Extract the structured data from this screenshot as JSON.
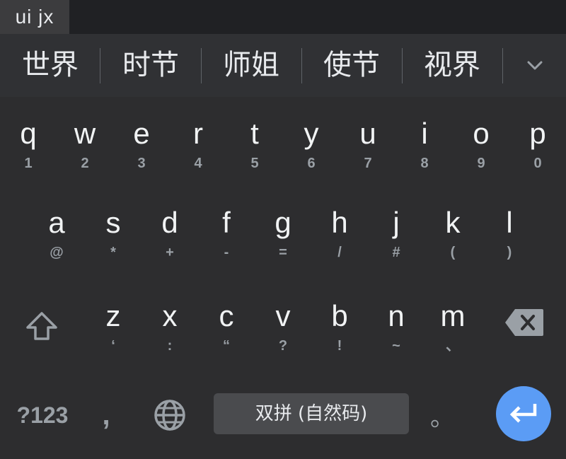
{
  "compose": {
    "text": "ui jx"
  },
  "candidates": {
    "items": [
      "世界",
      "时节",
      "师姐",
      "使节",
      "视界"
    ],
    "expand_icon": "chevron-down-icon"
  },
  "keyboard": {
    "row1": [
      {
        "main": "q",
        "hint": "1"
      },
      {
        "main": "w",
        "hint": "2"
      },
      {
        "main": "e",
        "hint": "3"
      },
      {
        "main": "r",
        "hint": "4"
      },
      {
        "main": "t",
        "hint": "5"
      },
      {
        "main": "y",
        "hint": "6"
      },
      {
        "main": "u",
        "hint": "7"
      },
      {
        "main": "i",
        "hint": "8"
      },
      {
        "main": "o",
        "hint": "9"
      },
      {
        "main": "p",
        "hint": "0"
      }
    ],
    "row2": [
      {
        "main": "a",
        "hint": "@"
      },
      {
        "main": "s",
        "hint": "*"
      },
      {
        "main": "d",
        "hint": "+"
      },
      {
        "main": "f",
        "hint": "-"
      },
      {
        "main": "g",
        "hint": "="
      },
      {
        "main": "h",
        "hint": "/"
      },
      {
        "main": "j",
        "hint": "#"
      },
      {
        "main": "k",
        "hint": "("
      },
      {
        "main": "l",
        "hint": ")"
      }
    ],
    "row3": [
      {
        "main": "z",
        "hint": "‘"
      },
      {
        "main": "x",
        "hint": ":"
      },
      {
        "main": "c",
        "hint": "“"
      },
      {
        "main": "v",
        "hint": "?"
      },
      {
        "main": "b",
        "hint": "!"
      },
      {
        "main": "n",
        "hint": "~"
      },
      {
        "main": "m",
        "hint": "、"
      }
    ],
    "shift_icon": "shift-icon",
    "backspace_icon": "backspace-icon",
    "symbols_label": "?123",
    "comma_label": ",",
    "globe_icon": "globe-icon",
    "space_label": "双拼 (自然码)",
    "period_label": "。",
    "enter_icon": "enter-icon"
  },
  "colors": {
    "background": "#2d2d2f",
    "candidate_bar": "#303134",
    "key_text": "#f1f3f4",
    "hint_text": "#9aa0a6",
    "space_key": "#4a4b4e",
    "enter_accent": "#5b9cf5"
  }
}
